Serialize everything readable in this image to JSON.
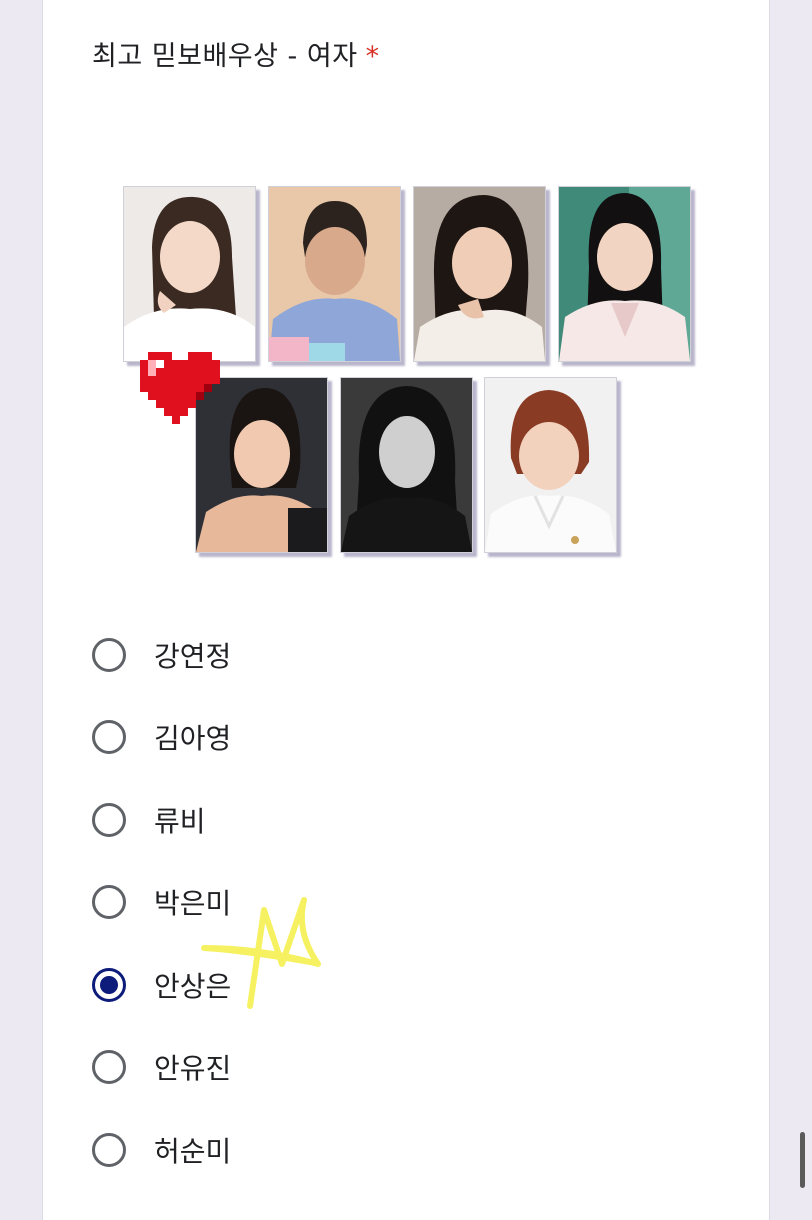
{
  "question": {
    "title": "최고 믿보배우상 - 여자",
    "required_mark": "*"
  },
  "options": [
    {
      "label": "강연정",
      "selected": false
    },
    {
      "label": "김아영",
      "selected": false
    },
    {
      "label": "류비",
      "selected": false
    },
    {
      "label": "박은미",
      "selected": false
    },
    {
      "label": "안상은",
      "selected": true
    },
    {
      "label": "안유진",
      "selected": false
    },
    {
      "label": "허순미",
      "selected": false
    }
  ],
  "colors": {
    "radio_selected": "#0d1b7a",
    "radio_unselected": "#5f6368",
    "required": "#d93025",
    "background": "#ece9f3"
  },
  "decorations": [
    "pixel-heart-sticker",
    "yellow-star-doodle"
  ]
}
